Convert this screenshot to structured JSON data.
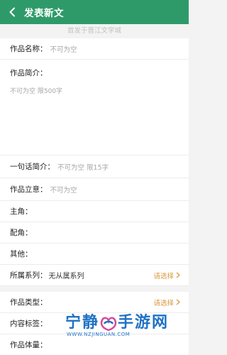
{
  "header": {
    "title": "发表新文"
  },
  "subtitle": "首发于晋江文学城",
  "fields": {
    "name": {
      "label": "作品名称：",
      "placeholder": "不可为空"
    },
    "intro": {
      "label": "作品简介：",
      "placeholder": "不可为空 限500字"
    },
    "one_line": {
      "label": "一句话简介：",
      "placeholder": "不可为空 限15字"
    },
    "theme": {
      "label": "作品立意：",
      "placeholder": "不可为空"
    },
    "lead": {
      "label": "主角："
    },
    "support": {
      "label": "配角："
    },
    "other": {
      "label": "其他："
    },
    "series": {
      "label": "所属系列：",
      "value": "无从属系列",
      "action": "请选择"
    },
    "type": {
      "label": "作品类型：",
      "action": "请选择"
    },
    "tags": {
      "label": "内容标签："
    },
    "length": {
      "label": "作品体量："
    }
  },
  "watermark": {
    "text_left": "宁静",
    "text_right": "手游网",
    "url": "WWW.NZJINGUAN.COM"
  },
  "colors": {
    "header_bg": "#2e9a6a",
    "accent": "#d9963a",
    "watermark": "#1f72c5"
  }
}
